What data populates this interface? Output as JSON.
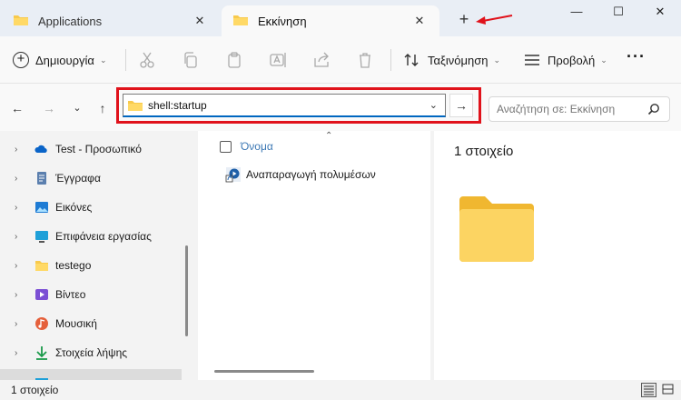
{
  "tabs": [
    {
      "label": "Applications",
      "active": false
    },
    {
      "label": "Εκκίνηση",
      "active": true
    }
  ],
  "window_controls": {
    "minimize": "—",
    "maximize": "☐",
    "close": "✕"
  },
  "commandbar": {
    "new_label": "Δημιουργία",
    "sort_label": "Ταξινόμηση",
    "view_label": "Προβολή",
    "more_label": "···"
  },
  "address": {
    "value": "shell:startup",
    "go_glyph": "→"
  },
  "search": {
    "placeholder": "Αναζήτηση σε: Εκκίνηση"
  },
  "sidebar": {
    "items": [
      {
        "label": "Test - Προσωπικό",
        "icon": "onedrive-cloud-icon"
      },
      {
        "label": "Έγγραφα",
        "icon": "documents-icon"
      },
      {
        "label": "Εικόνες",
        "icon": "pictures-icon"
      },
      {
        "label": "Επιφάνεια εργασίας",
        "icon": "desktop-icon"
      },
      {
        "label": "testego",
        "icon": "folder-icon"
      },
      {
        "label": "Βίντεο",
        "icon": "videos-icon"
      },
      {
        "label": "Μουσική",
        "icon": "music-icon"
      },
      {
        "label": "Στοιχεία λήψης",
        "icon": "downloads-icon"
      }
    ]
  },
  "filelist": {
    "column_name": "Όνομα",
    "files": [
      {
        "name": "Αναπαραγωγή πολυμέσων",
        "icon": "media-player-shortcut-icon"
      }
    ]
  },
  "preview": {
    "count_label": "1 στοιχείο"
  },
  "status": {
    "count_label": "1 στοιχείο"
  },
  "colors": {
    "accent": "#0067c0",
    "highlight_outline": "#e0121b",
    "folder_yellow": "#f8c94c"
  }
}
